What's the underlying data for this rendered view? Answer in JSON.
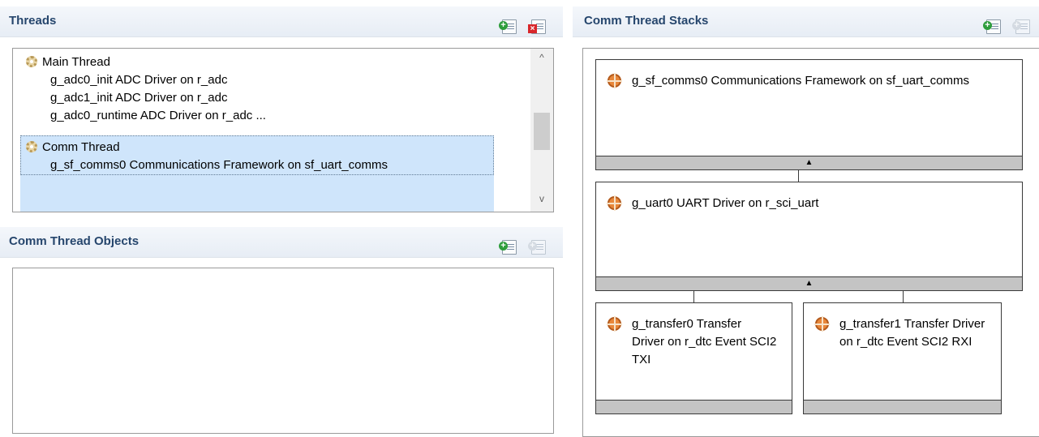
{
  "threads_panel": {
    "title": "Threads",
    "items": [
      {
        "label": "Main Thread",
        "type": "thread"
      },
      {
        "label": "g_adc0_init ADC Driver on r_adc",
        "type": "object"
      },
      {
        "label": "g_adc1_init ADC Driver on r_adc",
        "type": "object"
      },
      {
        "label": "g_adc0_runtime ADC Driver on r_adc ...",
        "type": "object"
      },
      {
        "label": "Comm Thread",
        "type": "thread",
        "selected": true
      },
      {
        "label": "g_sf_comms0 Communications Framework on sf_uart_comms",
        "type": "object",
        "selected": true
      }
    ],
    "scroll_up_glyph": "^",
    "scroll_down_glyph": "v"
  },
  "objects_panel": {
    "title": "Comm Thread Objects"
  },
  "stacks_panel": {
    "title": "Comm Thread Stacks",
    "modules": [
      {
        "id": "sf_comms",
        "text": "g_sf_comms0 Communications Framework on sf_uart_comms"
      },
      {
        "id": "uart",
        "text": "g_uart0 UART Driver on r_sci_uart"
      },
      {
        "id": "transfer0",
        "text": "g_transfer0 Transfer Driver on r_dtc Event SCI2 TXI"
      },
      {
        "id": "transfer1",
        "text": "g_transfer1 Transfer Driver on r_dtc Event SCI2 RXI"
      }
    ],
    "bar_arrow": "▲"
  },
  "icons": {
    "add": "add-item-icon",
    "remove": "remove-item-icon",
    "thread": "gear-thread-icon",
    "module": "crosshair-module-icon"
  },
  "colors": {
    "header_text": "#26466d",
    "selection": "#cfe5fb",
    "module_bar": "#c4c4c4"
  }
}
